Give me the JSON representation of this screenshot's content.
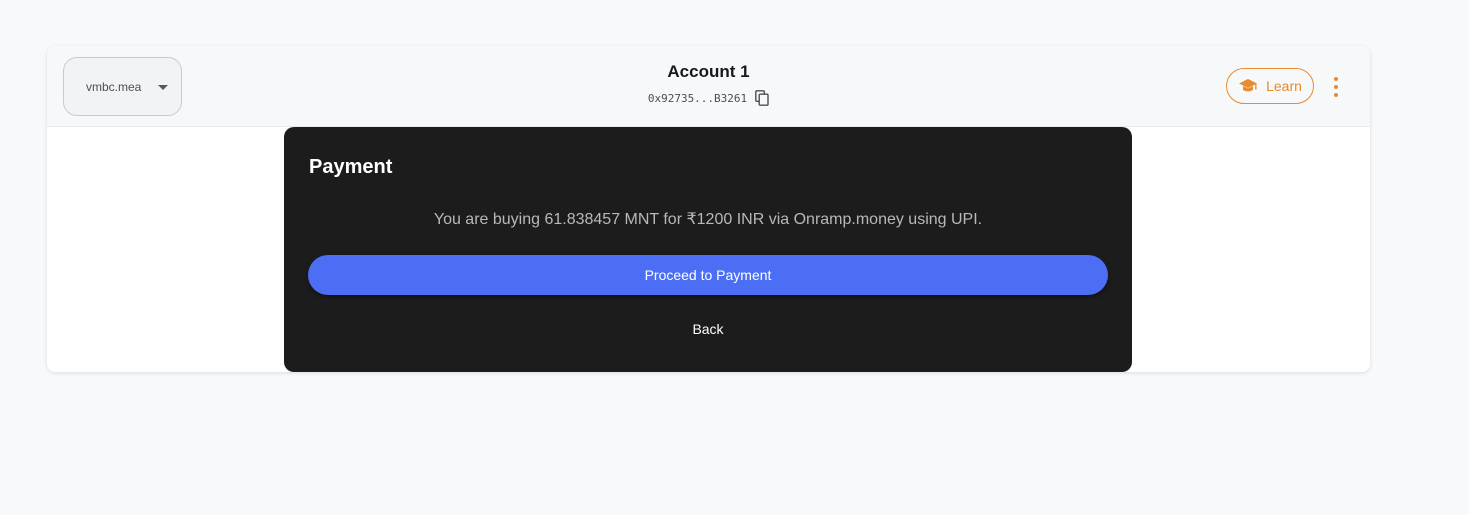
{
  "header": {
    "network_label": "vmbc.mea",
    "account_name": "Account 1",
    "address": "0x92735...B3261",
    "learn_label": "Learn"
  },
  "icons": {
    "network_dropdown": "chevron-down-icon",
    "copy": "copy-icon",
    "learn": "graduation-cap-icon",
    "menu": "kebab-menu-icon"
  },
  "modal": {
    "title": "Payment",
    "message": "You are buying 61.838457 MNT for ₹1200 INR via Onramp.money using UPI.",
    "proceed_label": "Proceed to Payment",
    "back_label": "Back"
  },
  "colors": {
    "accent_orange": "#e88a2e",
    "primary_blue": "#4c6ef5",
    "modal_background": "#1c1c1c"
  }
}
